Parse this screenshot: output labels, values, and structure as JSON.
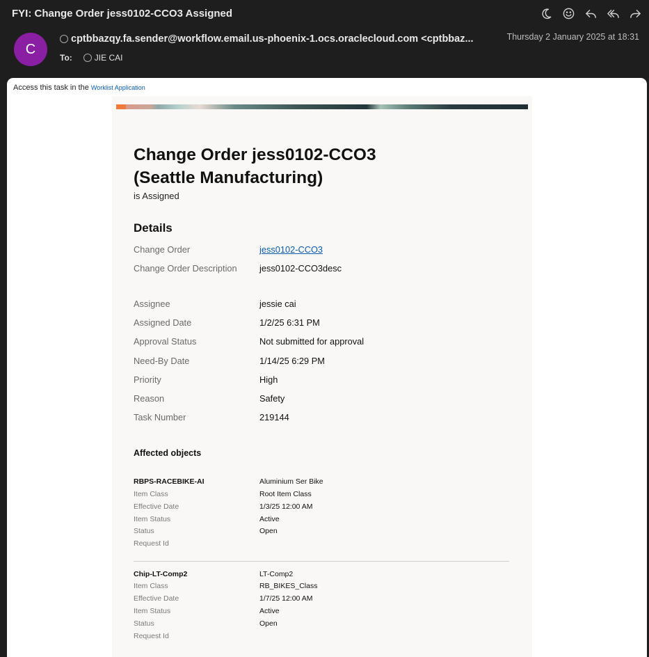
{
  "email": {
    "subject": "FYI: Change Order jess0102-CCO3 Assigned",
    "avatar_letter": "C",
    "from": "cptbbazqy.fa.sender@workflow.email.us-phoenix-1.ocs.oraclecloud.com <cptbbaz...",
    "date": "Thursday 2 January 2025 at 18:31",
    "to_label": "To:",
    "to": "JIE CAI",
    "actions": [
      "moon-icon",
      "emoji-icon",
      "reply-icon",
      "reply-all-icon",
      "forward-icon"
    ]
  },
  "body": {
    "access_text": "Access this task in the ",
    "access_link": "Worklist Application",
    "title": "Change Order jess0102-CCO3 (Seattle Manufacturing)",
    "subtitle": "is Assigned",
    "details_heading": "Details",
    "details": [
      {
        "label": "Change Order",
        "value": "jess0102-CCO3"
      },
      {
        "label": "Change Order Description",
        "value": "jess0102-CCO3desc"
      },
      {
        "label": "Assignee",
        "value": "jessie cai"
      },
      {
        "label": "Assigned Date",
        "value": "1/2/25 6:31 PM"
      },
      {
        "label": "Approval Status",
        "value": "Not submitted for approval"
      },
      {
        "label": "Need-By Date",
        "value": "1/14/25 6:29 PM"
      },
      {
        "label": "Priority",
        "value": "High"
      },
      {
        "label": "Reason",
        "value": "Safety"
      },
      {
        "label": "Task Number",
        "value": "219144"
      }
    ],
    "affected_heading": "Affected objects",
    "affected": [
      {
        "name": "RBPS-RACEBIKE-AI",
        "desc": "Aluminium Ser Bike",
        "rows": [
          {
            "label": "Item Class",
            "value": "Root Item Class"
          },
          {
            "label": "Effective Date",
            "value": "1/3/25 12:00 AM"
          },
          {
            "label": "Item Status",
            "value": "Active"
          },
          {
            "label": "Status",
            "value": "Open"
          },
          {
            "label": "Request Id",
            "value": ""
          }
        ]
      },
      {
        "name": "Chip-LT-Comp2",
        "desc": "LT-Comp2",
        "rows": [
          {
            "label": "Item Class",
            "value": "RB_BIKES_Class"
          },
          {
            "label": "Effective Date",
            "value": "1/7/25 12:00 AM"
          },
          {
            "label": "Item Status",
            "value": "Active"
          },
          {
            "label": "Status",
            "value": "Open"
          },
          {
            "label": "Request Id",
            "value": ""
          }
        ]
      }
    ]
  }
}
